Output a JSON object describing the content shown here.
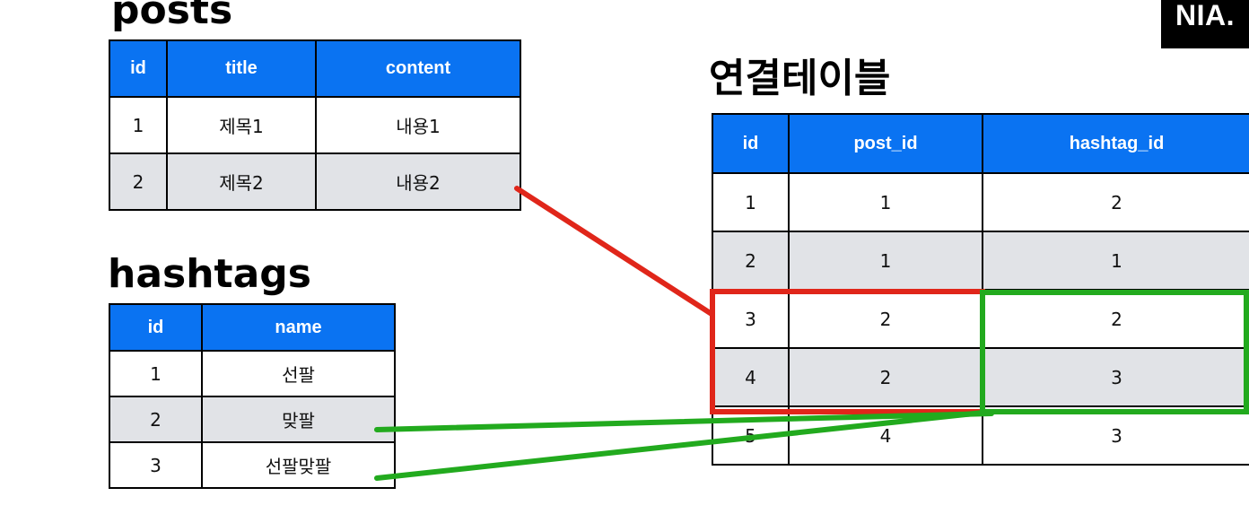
{
  "logo": {
    "text": "NIA."
  },
  "posts": {
    "title": "posts",
    "columns": [
      "id",
      "title",
      "content"
    ],
    "rows": [
      [
        "1",
        "제목1",
        "내용1"
      ],
      [
        "2",
        "제목2",
        "내용2"
      ]
    ]
  },
  "hashtags": {
    "title": "hashtags",
    "columns": [
      "id",
      "name"
    ],
    "rows": [
      [
        "1",
        "선팔"
      ],
      [
        "2",
        "맞팔"
      ],
      [
        "3",
        "선팔맞팔"
      ]
    ]
  },
  "link_table": {
    "title": "연결테이블",
    "columns": [
      "id",
      "post_id",
      "hashtag_id"
    ],
    "rows": [
      [
        "1",
        "1",
        "2"
      ],
      [
        "2",
        "1",
        "1"
      ],
      [
        "3",
        "2",
        "2"
      ],
      [
        "4",
        "2",
        "3"
      ],
      [
        "5",
        "4",
        "3"
      ]
    ]
  },
  "colors": {
    "header_blue": "#0a73f2",
    "row_shade": "#e1e3e7",
    "highlight_red": "#e0261a",
    "highlight_green": "#22aa1e"
  }
}
